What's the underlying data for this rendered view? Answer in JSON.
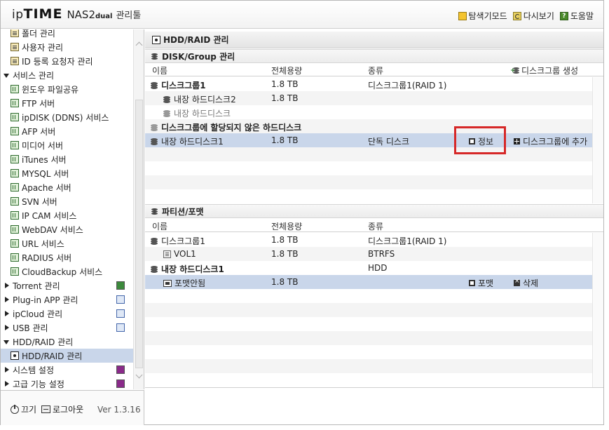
{
  "header": {
    "brand_ip": "ip",
    "brand_time": "TIME",
    "brand_model": "NAS2",
    "brand_sub": "dual",
    "brand_admin": "관리툴",
    "links": [
      "탐색기모드",
      "다시보기",
      "도움말"
    ]
  },
  "sidebar": {
    "rows": [
      {
        "label": "폴더 관리",
        "kind": "item",
        "icon": "doc-icon"
      },
      {
        "label": "사용자 관리",
        "kind": "item",
        "icon": "doc-icon"
      },
      {
        "label": "ID 등록 요청자 관리",
        "kind": "item",
        "icon": "doc-icon"
      },
      {
        "label": "서비스 관리",
        "kind": "category",
        "expanded": true
      },
      {
        "label": "윈도우 파일공유",
        "kind": "item",
        "icon": "grid-icon"
      },
      {
        "label": "FTP 서버",
        "kind": "item",
        "icon": "grid-icon"
      },
      {
        "label": "ipDISK (DDNS) 서비스",
        "kind": "item",
        "icon": "grid-icon"
      },
      {
        "label": "AFP 서버",
        "kind": "item",
        "icon": "grid-icon"
      },
      {
        "label": "미디어 서버",
        "kind": "item",
        "icon": "grid-icon"
      },
      {
        "label": "iTunes 서버",
        "kind": "item",
        "icon": "grid-icon"
      },
      {
        "label": "MYSQL 서버",
        "kind": "item",
        "icon": "grid-icon"
      },
      {
        "label": "Apache 서버",
        "kind": "item",
        "icon": "grid-icon"
      },
      {
        "label": "SVN 서버",
        "kind": "item",
        "icon": "grid-icon"
      },
      {
        "label": "IP CAM 서비스",
        "kind": "item",
        "icon": "grid-icon"
      },
      {
        "label": "WebDAV 서비스",
        "kind": "item",
        "icon": "grid-icon"
      },
      {
        "label": "URL 서비스",
        "kind": "item",
        "icon": "grid-icon"
      },
      {
        "label": "RADIUS 서버",
        "kind": "item",
        "icon": "grid-icon"
      },
      {
        "label": "CloudBackup 서비스",
        "kind": "item",
        "icon": "grid-icon"
      },
      {
        "label": "Torrent 관리",
        "kind": "category",
        "expanded": false,
        "badge": "green"
      },
      {
        "label": "Plug-in APP 관리",
        "kind": "category",
        "expanded": false,
        "badge": "blue"
      },
      {
        "label": "ipCloud 관리",
        "kind": "category",
        "expanded": false,
        "badge": "blue"
      },
      {
        "label": "USB 관리",
        "kind": "category",
        "expanded": false,
        "badge": "blue"
      },
      {
        "label": "HDD/RAID 관리",
        "kind": "category",
        "expanded": true
      },
      {
        "label": "HDD/RAID 관리",
        "kind": "item",
        "icon": "hdd-icon",
        "selected": true
      },
      {
        "label": "시스템 설정",
        "kind": "category",
        "expanded": false,
        "badge": "purple"
      },
      {
        "label": "고급 기능 설정",
        "kind": "category",
        "expanded": false,
        "badge": "purple"
      }
    ]
  },
  "footer": {
    "off_label": "끄기",
    "logout_label": "로그아웃",
    "version": "Ver 1.3.16"
  },
  "main": {
    "title": "HDD/RAID 관리",
    "disk_section": {
      "title": "DISK/Group 관리",
      "columns": [
        "이름",
        "전체용량",
        "종류"
      ],
      "create_label": "디스크그룹 생성",
      "rows": [
        {
          "name": "디스크그룹1",
          "size": "1.8 TB",
          "type": "디스크그룹1(RAID 1)",
          "style": "group"
        },
        {
          "name": "내장 하드디스크2",
          "size": "1.8 TB",
          "type": "",
          "style": "member"
        },
        {
          "name": "내장 하드디스크",
          "size": "",
          "type": "",
          "style": "member-muted"
        },
        {
          "name": "디스크그룹에 할당되지 않은 하드디스크",
          "size": "",
          "type": "",
          "style": "unassigned"
        },
        {
          "name": "내장 하드디스크1",
          "size": "1.8 TB",
          "type": "단독 디스크",
          "style": "selected",
          "info_label": "정보",
          "add_label": "디스크그룹에 추가"
        }
      ]
    },
    "partition_section": {
      "title": "파티션/포맷",
      "columns": [
        "이름",
        "전체용량",
        "종류"
      ],
      "rows": [
        {
          "name": "디스크그룹1",
          "size": "1.8 TB",
          "type": "디스크그룹1(RAID 1)",
          "style": "group-plain"
        },
        {
          "name": "VOL1",
          "size": "1.8 TB",
          "type": "BTRFS",
          "style": "volume"
        },
        {
          "name": "내장 하드디스크1",
          "size": "",
          "type": "HDD",
          "style": "disk-bold"
        },
        {
          "name": "포맷안됨",
          "size": "1.8 TB",
          "type": "",
          "style": "selected",
          "format_label": "포맷",
          "delete_label": "삭제"
        }
      ]
    }
  },
  "colors": {
    "selected_row": "#c9d6ea",
    "highlight_box": "#d62828"
  }
}
